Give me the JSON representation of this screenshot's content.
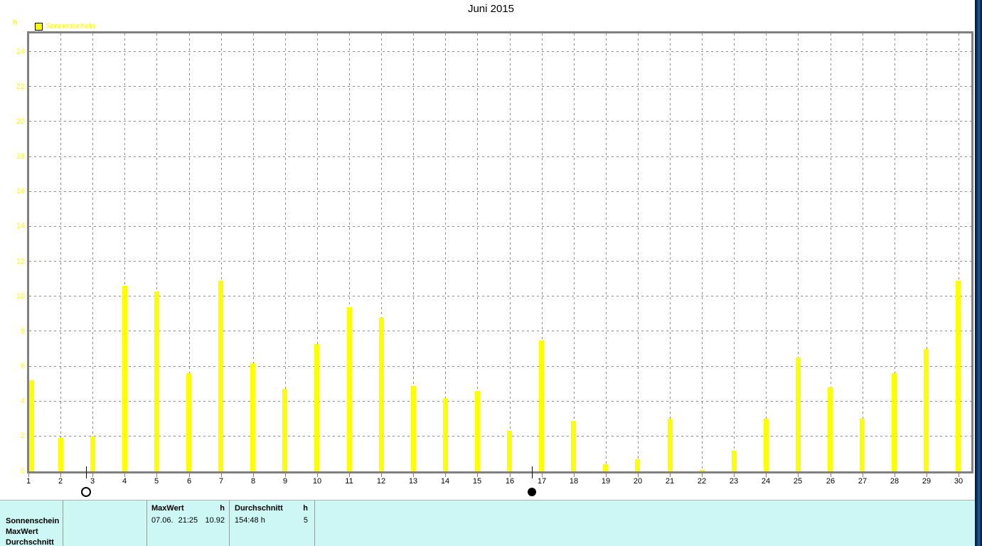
{
  "window": {
    "title": "Juni 2015"
  },
  "chart_data": {
    "type": "bar",
    "title": "Juni 2015",
    "ylabel_unit": "h",
    "legend": [
      {
        "label": "Sonnenschein",
        "color": "#ffff00"
      }
    ],
    "categories": [
      1,
      2,
      3,
      4,
      5,
      6,
      7,
      8,
      9,
      10,
      11,
      12,
      13,
      14,
      15,
      16,
      17,
      18,
      19,
      20,
      21,
      22,
      23,
      24,
      25,
      26,
      27,
      28,
      29,
      30
    ],
    "series": [
      {
        "name": "Sonnenschein",
        "color": "#ffff00",
        "values": [
          5.2,
          1.9,
          2.0,
          10.6,
          10.3,
          5.6,
          10.92,
          6.2,
          4.7,
          7.3,
          9.4,
          8.8,
          4.9,
          4.2,
          4.6,
          2.3,
          7.5,
          2.9,
          0.4,
          0.7,
          3.0,
          0.1,
          1.2,
          3.0,
          6.5,
          4.8,
          3.0,
          5.6,
          7.0,
          10.9
        ]
      }
    ],
    "ylim": [
      0,
      24
    ],
    "ytick_step": 2,
    "grid": true,
    "legend_position": "top-left",
    "annotations": {
      "max_value": {
        "date": "07.06.",
        "time": "21:25",
        "value": 10.92
      },
      "moon_phases": [
        {
          "symbol": "full-moon",
          "day": 2.8
        },
        {
          "symbol": "new-moon",
          "day": 16.7
        }
      ]
    }
  },
  "status_bar": {
    "row_labels": [
      "Sonnenschein",
      "MaxWert",
      "Durchschnitt"
    ],
    "maxwert": {
      "label": "MaxWert",
      "unit": "h",
      "date": "07.06.",
      "time": "21:25",
      "value": "10.92"
    },
    "durchschnitt": {
      "label": "Durchschnitt",
      "unit": "h",
      "total": "154:48 h",
      "value": "5"
    }
  },
  "colors": {
    "bar": "#ffff00",
    "axis": "#808080",
    "grid": "#8c8c8c",
    "ylabel": "#ffff00",
    "status_bg": "#cdf7f4",
    "desktop_edge": "#0d3a6e"
  }
}
